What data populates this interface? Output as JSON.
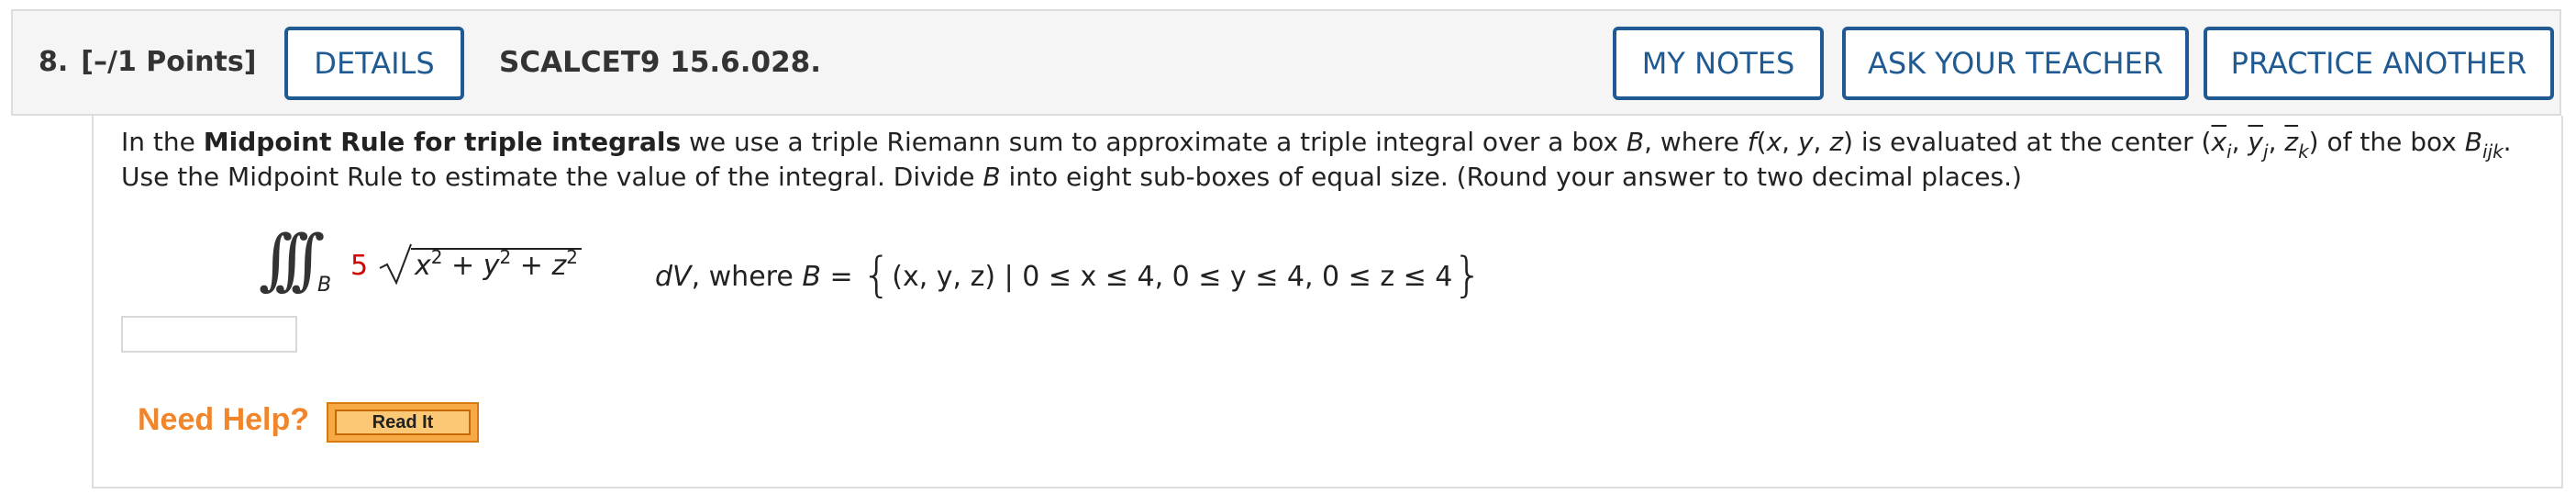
{
  "header": {
    "question_number": "8.",
    "points": "[–/1 Points]",
    "details_label": "DETAILS",
    "reference": "SCALCET9 15.6.028.",
    "my_notes_label": "MY NOTES",
    "ask_teacher_label": "ASK YOUR TEACHER",
    "practice_label": "PRACTICE ANOTHER"
  },
  "problem": {
    "p1": "In the ",
    "p1_bold": "Midpoint Rule for triple integrals",
    "p2": " we use a triple Riemann sum to approximate a triple integral over a box ",
    "B": "B",
    "p3": ", where ",
    "f": "f",
    "p4": "(",
    "x": "x",
    "comma1": ", ",
    "y": "y",
    "comma2": ", ",
    "z": "z",
    "p5": ") is evaluated at the center (",
    "xbar": "x",
    "i": "i",
    "ybar": "y",
    "j": "j",
    "zbar": "z",
    "k": "k",
    "p6": ") of the box ",
    "Bijk": "B",
    "ijk": "ijk",
    "p7": ". Use the Midpoint Rule to estimate the value of the integral. Divide ",
    "B2": "B",
    "p8": " into eight sub-boxes of equal size. (Round your answer to two decimal places.)"
  },
  "math": {
    "integrals": "∫∫∫",
    "integral_sub": "B",
    "coefficient": "5",
    "radicand_x": "x",
    "radicand_y": "y",
    "radicand_z": "z",
    "exp": "2",
    "plus": " + ",
    "dV": "dV",
    "where": ", where ",
    "Bvar": "B",
    "equals": " = ",
    "set_open": "{",
    "set_body": "(x, y, z) | 0 ≤ x ≤ 4, 0 ≤ y ≤ 4, 0 ≤ z ≤ 4",
    "set_close": "}"
  },
  "answer": {
    "value": ""
  },
  "help": {
    "label": "Need Help?",
    "read_it_label": "Read It"
  }
}
